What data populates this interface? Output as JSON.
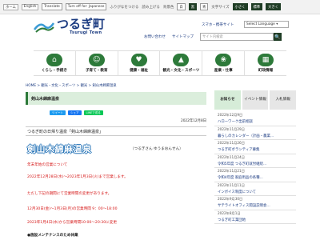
{
  "topbar": {
    "home_chip": "ホーム",
    "lang_chip": "English",
    "translate_btn": "Translate",
    "japanese_btn": "Turn off for: Japanese",
    "links": [
      "ふりがなをつける",
      "読み上げる"
    ],
    "color_label": "背景色",
    "color_opts": [
      "白",
      "黒",
      "青"
    ],
    "textsize_label": "文字サイズ",
    "textsize_opts": [
      "小さく",
      "標準",
      "大きく"
    ]
  },
  "header": {
    "logo_title": "つるぎ町",
    "logo_sub": "Tsurugi Town",
    "links": [
      "スマホ・携帯サイト",
      "Select Language ▾"
    ],
    "links2": [
      "お問い合わせ",
      "サイトマップ"
    ],
    "search_placeholder": "サイト内検索",
    "search_icon": "🔍"
  },
  "nav": [
    {
      "label": "くらし・手続き",
      "icon": "⌂",
      "icon_name": "house-icon"
    },
    {
      "label": "子育て・教育",
      "icon": "☺",
      "icon_name": "child-icon"
    },
    {
      "label": "健康・福祉",
      "icon": "♥",
      "icon_name": "heart-icon"
    },
    {
      "label": "観光・文化・スポーツ",
      "icon": "▲",
      "icon_name": "mountain-icon"
    },
    {
      "label": "産業・仕事",
      "icon": "❀",
      "icon_name": "leaf-icon"
    },
    {
      "label": "町政情報",
      "icon": "▦",
      "icon_name": "building-icon"
    }
  ],
  "breadcrumb": "HOME > 観光・文化・スポーツ > 観光 > 剣山木綿麻温泉",
  "page_title": "剣山木綿麻温泉",
  "share": [
    "ツイート",
    "シェア",
    "LINEで送る"
  ],
  "update_date": "2022年12月8日",
  "section_head": "つるぎ町の日帰り温泉「剣山木綿麻温泉」",
  "big_title": "剣山木綿麻温泉",
  "reading": "（つるぎさん ゆうまおんせん）",
  "body": {
    "red1": "年末年始の営業について",
    "red2": "2022年12月28日(水)～2023年1月3日(火)まで営業します。",
    "red3": "ただし下記の期間にて営業時間の変更があります。",
    "red4": "12月30日(金)～1月3日(月)の営業時間 9：00～18:00",
    "red5": "2023年1月4日(水)から営業時間10:00～20:30に変更",
    "black1": "●施設メンテナンスのため休業"
  },
  "sidebar": {
    "tabs": [
      "お知らせ",
      "イベント情報",
      "入札情報"
    ],
    "entries": [
      {
        "date": "2022年12月9日",
        "title": "ハローワーク出前相談"
      },
      {
        "date": "2022年11月29日",
        "title": "暮らしのカレンダー（計画・農業…"
      },
      {
        "date": "2022年11月26日",
        "title": "つるぎ町ボランティア募集"
      },
      {
        "date": "2022年11月24日",
        "title": "令和5年度 つるぎ町就労継続…"
      },
      {
        "date": "2022年11月21日",
        "title": "令和4年度 家庭用品の各種…"
      },
      {
        "date": "2022年11月11日",
        "title": "インボイス制度について"
      },
      {
        "date": "2022年9月30日",
        "title": "サテライトオフィス開設説明会…"
      },
      {
        "date": "2022年8月1日",
        "title": "つるぎ町工業団地"
      }
    ]
  }
}
